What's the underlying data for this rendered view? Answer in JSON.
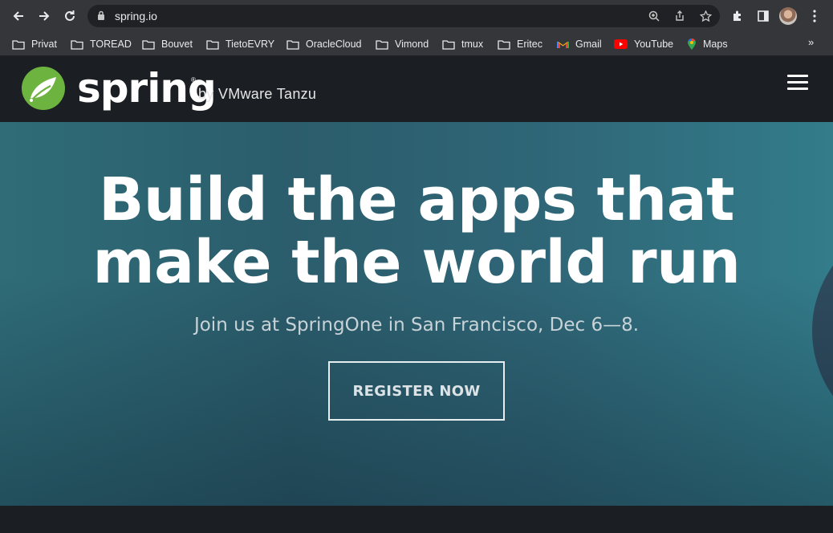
{
  "browser": {
    "url": "spring.io",
    "bookmarks": [
      {
        "label": "Privat",
        "icon": "folder-icon"
      },
      {
        "label": "TOREAD",
        "icon": "folder-icon"
      },
      {
        "label": "Bouvet",
        "icon": "folder-icon"
      },
      {
        "label": "TietoEVRY",
        "icon": "folder-icon"
      },
      {
        "label": "OracleCloud",
        "icon": "folder-icon"
      },
      {
        "label": "Vimond",
        "icon": "folder-icon"
      },
      {
        "label": "tmux",
        "icon": "folder-icon"
      },
      {
        "label": "Eritec",
        "icon": "folder-icon"
      },
      {
        "label": "Gmail",
        "icon": "gmail-icon"
      },
      {
        "label": "YouTube",
        "icon": "youtube-icon"
      },
      {
        "label": "Maps",
        "icon": "maps-icon"
      }
    ],
    "more_label": "»"
  },
  "site": {
    "logo_text": "spring",
    "logo_reg": "®",
    "tagline": "by VMware Tanzu"
  },
  "hero": {
    "title_line1": "Build the apps that",
    "title_line2": "make the world run",
    "subtitle": "Join us at SpringOne in San Francisco, Dec 6—8.",
    "cta_label": "REGISTER NOW"
  },
  "colors": {
    "header_bg": "#1b1f23",
    "hero_teal": "#2f6c78",
    "spring_green": "#6db33f"
  }
}
